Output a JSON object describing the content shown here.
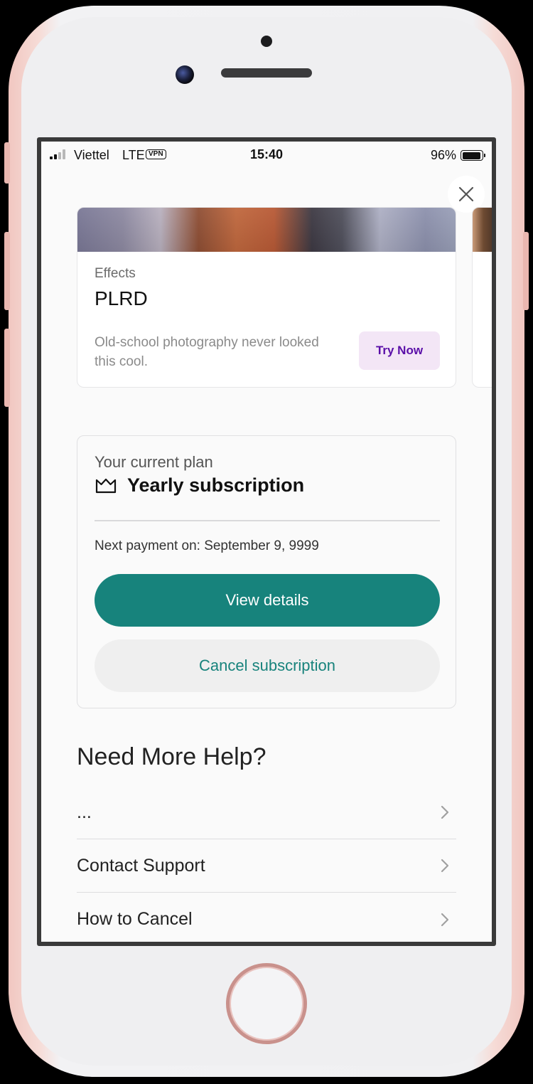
{
  "status_bar": {
    "carrier": "Viettel",
    "network": "LTE",
    "vpn": "VPN",
    "time": "15:40",
    "battery": "96%",
    "battery_level": 0.96
  },
  "feature_card": {
    "category": "Effects",
    "name": "PLRD",
    "description": "Old-school photography never looked this cool.",
    "cta_label": "Try Now",
    "cta_text_color": "#5a0fa8",
    "cta_bg_color": "#f3e6f6"
  },
  "plan": {
    "caption": "Your current plan",
    "title": "Yearly subscription",
    "icon": "crown-icon",
    "next_payment": "Next payment on: September 9, 9999",
    "view_details_label": "View details",
    "cancel_label": "Cancel subscription",
    "accent_color": "#17837c"
  },
  "help": {
    "heading": "Need More Help?",
    "items": [
      {
        "label": "..."
      },
      {
        "label": "Contact Support"
      },
      {
        "label": "How to Cancel"
      }
    ]
  },
  "icons": {
    "close": "close-icon",
    "chevron": "chevron-right-icon"
  }
}
